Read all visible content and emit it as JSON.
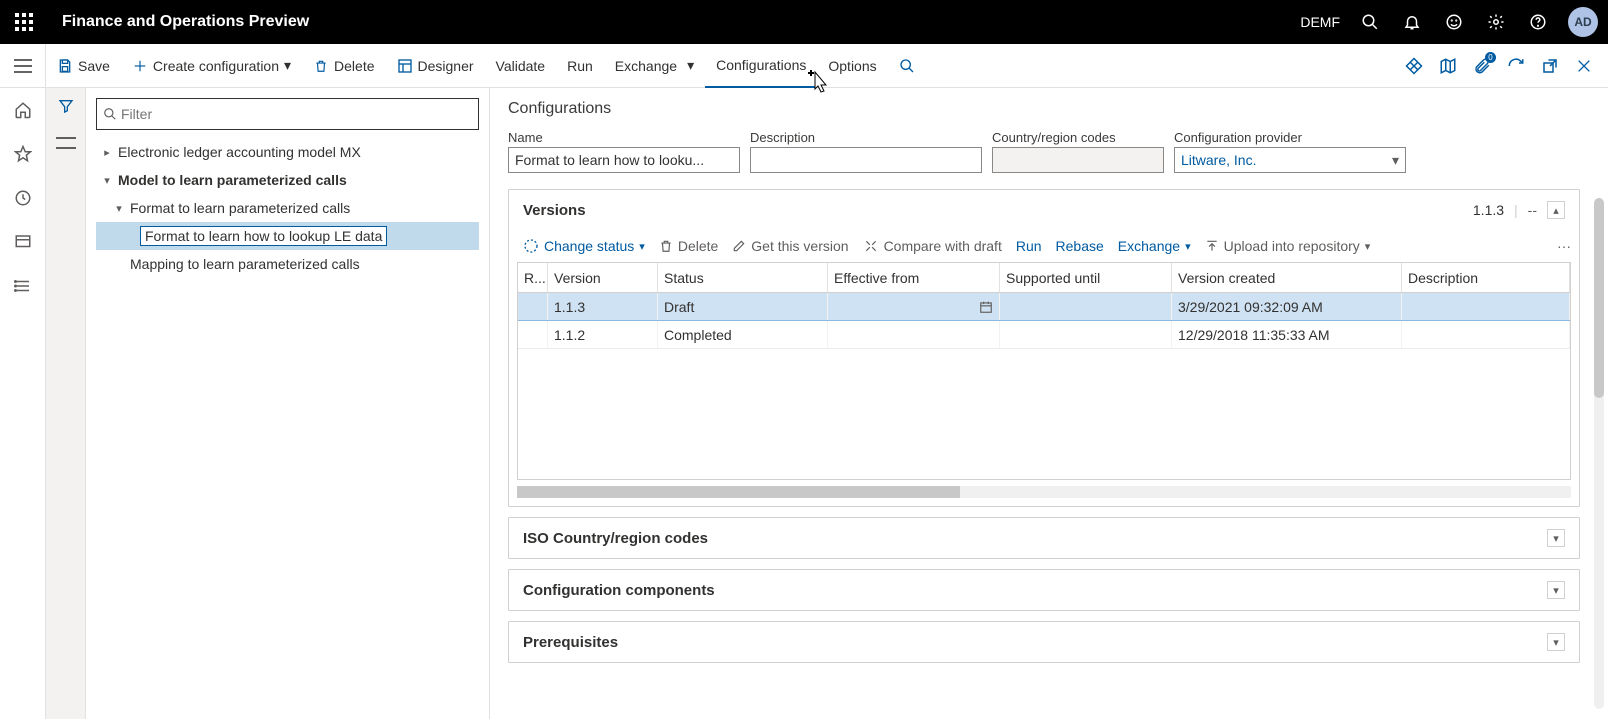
{
  "header": {
    "app_title": "Finance and Operations Preview",
    "company": "DEMF",
    "avatar": "AD"
  },
  "cmdbar": {
    "save": "Save",
    "create": "Create configuration",
    "delete": "Delete",
    "designer": "Designer",
    "validate": "Validate",
    "run": "Run",
    "exchange": "Exchange",
    "configurations": "Configurations",
    "options": "Options",
    "badge": "0"
  },
  "filter": {
    "placeholder": "Filter"
  },
  "tree": {
    "item0": "Electronic ledger accounting model MX",
    "item1": "Model to learn parameterized calls",
    "item2": "Format to learn parameterized calls",
    "item3": "Format to learn how to lookup LE data",
    "item4": "Mapping to learn parameterized calls"
  },
  "detail": {
    "section": "Configurations",
    "labels": {
      "name": "Name",
      "description": "Description",
      "country": "Country/region codes",
      "provider": "Configuration provider"
    },
    "values": {
      "name": "Format to learn how to looku...",
      "description": "",
      "country": "",
      "provider": "Litware, Inc."
    }
  },
  "versions": {
    "title": "Versions",
    "current": "1.1.3",
    "dash": "--",
    "toolbar": {
      "change_status": "Change status",
      "delete": "Delete",
      "get_version": "Get this version",
      "compare": "Compare with draft",
      "run": "Run",
      "rebase": "Rebase",
      "exchange": "Exchange",
      "upload": "Upload into repository"
    },
    "columns": {
      "rownum": "R...",
      "version": "Version",
      "status": "Status",
      "effective": "Effective from",
      "supported": "Supported until",
      "created": "Version created",
      "description": "Description"
    },
    "row1": {
      "version": "1.1.3",
      "status": "Draft",
      "eff": "",
      "sup": "",
      "created": "3/29/2021 09:32:09 AM",
      "desc": ""
    },
    "row2": {
      "version": "1.1.2",
      "status": "Completed",
      "eff": "",
      "sup": "",
      "created": "12/29/2018 11:35:33 AM",
      "desc": ""
    }
  },
  "panels": {
    "iso": "ISO Country/region codes",
    "components": "Configuration components",
    "prereq": "Prerequisites"
  }
}
